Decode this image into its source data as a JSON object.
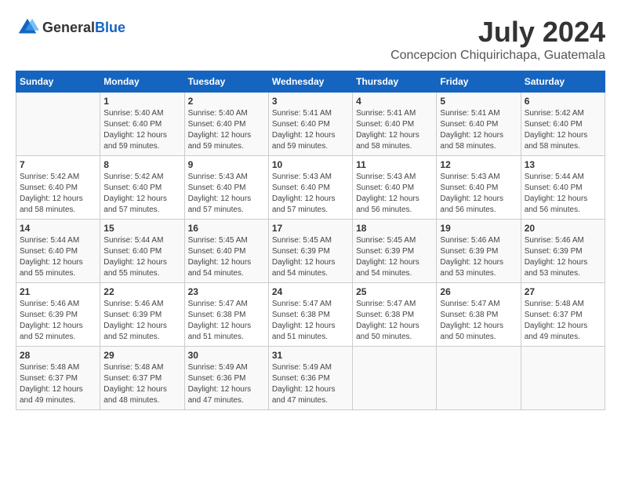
{
  "header": {
    "logo_general": "General",
    "logo_blue": "Blue",
    "month_year": "July 2024",
    "location": "Concepcion Chiquirichapa, Guatemala"
  },
  "days_of_week": [
    "Sunday",
    "Monday",
    "Tuesday",
    "Wednesday",
    "Thursday",
    "Friday",
    "Saturday"
  ],
  "weeks": [
    [
      {
        "day": "",
        "info": ""
      },
      {
        "day": "1",
        "info": "Sunrise: 5:40 AM\nSunset: 6:40 PM\nDaylight: 12 hours\nand 59 minutes."
      },
      {
        "day": "2",
        "info": "Sunrise: 5:40 AM\nSunset: 6:40 PM\nDaylight: 12 hours\nand 59 minutes."
      },
      {
        "day": "3",
        "info": "Sunrise: 5:41 AM\nSunset: 6:40 PM\nDaylight: 12 hours\nand 59 minutes."
      },
      {
        "day": "4",
        "info": "Sunrise: 5:41 AM\nSunset: 6:40 PM\nDaylight: 12 hours\nand 58 minutes."
      },
      {
        "day": "5",
        "info": "Sunrise: 5:41 AM\nSunset: 6:40 PM\nDaylight: 12 hours\nand 58 minutes."
      },
      {
        "day": "6",
        "info": "Sunrise: 5:42 AM\nSunset: 6:40 PM\nDaylight: 12 hours\nand 58 minutes."
      }
    ],
    [
      {
        "day": "7",
        "info": "Sunrise: 5:42 AM\nSunset: 6:40 PM\nDaylight: 12 hours\nand 58 minutes."
      },
      {
        "day": "8",
        "info": "Sunrise: 5:42 AM\nSunset: 6:40 PM\nDaylight: 12 hours\nand 57 minutes."
      },
      {
        "day": "9",
        "info": "Sunrise: 5:43 AM\nSunset: 6:40 PM\nDaylight: 12 hours\nand 57 minutes."
      },
      {
        "day": "10",
        "info": "Sunrise: 5:43 AM\nSunset: 6:40 PM\nDaylight: 12 hours\nand 57 minutes."
      },
      {
        "day": "11",
        "info": "Sunrise: 5:43 AM\nSunset: 6:40 PM\nDaylight: 12 hours\nand 56 minutes."
      },
      {
        "day": "12",
        "info": "Sunrise: 5:43 AM\nSunset: 6:40 PM\nDaylight: 12 hours\nand 56 minutes."
      },
      {
        "day": "13",
        "info": "Sunrise: 5:44 AM\nSunset: 6:40 PM\nDaylight: 12 hours\nand 56 minutes."
      }
    ],
    [
      {
        "day": "14",
        "info": "Sunrise: 5:44 AM\nSunset: 6:40 PM\nDaylight: 12 hours\nand 55 minutes."
      },
      {
        "day": "15",
        "info": "Sunrise: 5:44 AM\nSunset: 6:40 PM\nDaylight: 12 hours\nand 55 minutes."
      },
      {
        "day": "16",
        "info": "Sunrise: 5:45 AM\nSunset: 6:40 PM\nDaylight: 12 hours\nand 54 minutes."
      },
      {
        "day": "17",
        "info": "Sunrise: 5:45 AM\nSunset: 6:39 PM\nDaylight: 12 hours\nand 54 minutes."
      },
      {
        "day": "18",
        "info": "Sunrise: 5:45 AM\nSunset: 6:39 PM\nDaylight: 12 hours\nand 54 minutes."
      },
      {
        "day": "19",
        "info": "Sunrise: 5:46 AM\nSunset: 6:39 PM\nDaylight: 12 hours\nand 53 minutes."
      },
      {
        "day": "20",
        "info": "Sunrise: 5:46 AM\nSunset: 6:39 PM\nDaylight: 12 hours\nand 53 minutes."
      }
    ],
    [
      {
        "day": "21",
        "info": "Sunrise: 5:46 AM\nSunset: 6:39 PM\nDaylight: 12 hours\nand 52 minutes."
      },
      {
        "day": "22",
        "info": "Sunrise: 5:46 AM\nSunset: 6:39 PM\nDaylight: 12 hours\nand 52 minutes."
      },
      {
        "day": "23",
        "info": "Sunrise: 5:47 AM\nSunset: 6:38 PM\nDaylight: 12 hours\nand 51 minutes."
      },
      {
        "day": "24",
        "info": "Sunrise: 5:47 AM\nSunset: 6:38 PM\nDaylight: 12 hours\nand 51 minutes."
      },
      {
        "day": "25",
        "info": "Sunrise: 5:47 AM\nSunset: 6:38 PM\nDaylight: 12 hours\nand 50 minutes."
      },
      {
        "day": "26",
        "info": "Sunrise: 5:47 AM\nSunset: 6:38 PM\nDaylight: 12 hours\nand 50 minutes."
      },
      {
        "day": "27",
        "info": "Sunrise: 5:48 AM\nSunset: 6:37 PM\nDaylight: 12 hours\nand 49 minutes."
      }
    ],
    [
      {
        "day": "28",
        "info": "Sunrise: 5:48 AM\nSunset: 6:37 PM\nDaylight: 12 hours\nand 49 minutes."
      },
      {
        "day": "29",
        "info": "Sunrise: 5:48 AM\nSunset: 6:37 PM\nDaylight: 12 hours\nand 48 minutes."
      },
      {
        "day": "30",
        "info": "Sunrise: 5:49 AM\nSunset: 6:36 PM\nDaylight: 12 hours\nand 47 minutes."
      },
      {
        "day": "31",
        "info": "Sunrise: 5:49 AM\nSunset: 6:36 PM\nDaylight: 12 hours\nand 47 minutes."
      },
      {
        "day": "",
        "info": ""
      },
      {
        "day": "",
        "info": ""
      },
      {
        "day": "",
        "info": ""
      }
    ]
  ]
}
